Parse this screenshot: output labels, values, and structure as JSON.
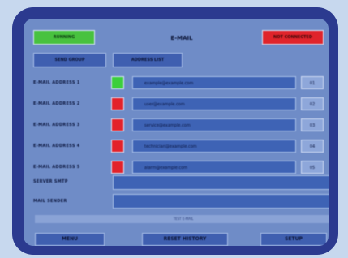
{
  "header": {
    "left_button": "RUNNING",
    "title": "E-MAIL",
    "right_button": "NOT CONNECTED"
  },
  "tabs": [
    "SEND GROUP",
    "ADDRESS LIST"
  ],
  "rows": [
    {
      "label": "E-MAIL ADDRESS 1",
      "status": "on",
      "address": "example@example.com",
      "channel": "01"
    },
    {
      "label": "E-MAIL ADDRESS 2",
      "status": "off",
      "address": "user@example.com",
      "channel": "02"
    },
    {
      "label": "E-MAIL ADDRESS 3",
      "status": "off",
      "address": "service@example.com",
      "channel": "03"
    },
    {
      "label": "E-MAIL ADDRESS 4",
      "status": "off",
      "address": "technician@example.com",
      "channel": "04"
    },
    {
      "label": "E-MAIL ADDRESS 5",
      "status": "off",
      "address": "alarm@example.com",
      "channel": "05"
    }
  ],
  "extra_fields": [
    {
      "label": "SERVER SMTP",
      "value": ""
    },
    {
      "label": "MAIL SENDER",
      "value": ""
    }
  ],
  "status_bar": "TEST E-MAIL",
  "footer": {
    "menu": "MENU",
    "center": "RESET HISTORY",
    "setup": "SETUP"
  },
  "colors": {
    "bezel": "#2b3a8f",
    "screen": "#6f8cc7",
    "on": "#3ccf3c",
    "off": "#e3222a"
  }
}
